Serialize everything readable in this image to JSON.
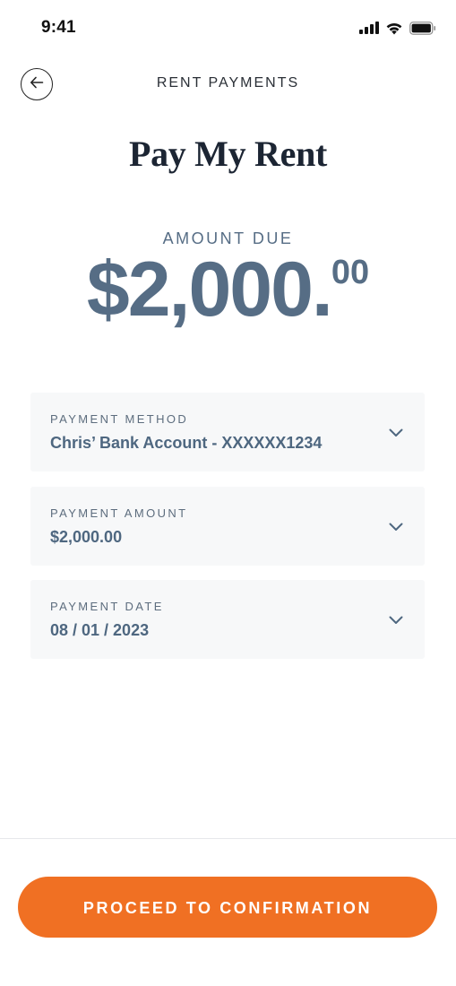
{
  "status_bar": {
    "time": "9:41",
    "icons": [
      "cellular-signal-icon",
      "wifi-icon",
      "battery-icon"
    ]
  },
  "header": {
    "back_icon": "arrow-left-icon",
    "nav_title": "RENT PAYMENTS",
    "page_title": "Pay My Rent"
  },
  "amount_due": {
    "label": "AMOUNT DUE",
    "value_main": "$2,000.",
    "value_cents": "00"
  },
  "fields": [
    {
      "label": "PAYMENT METHOD",
      "value": "Chris’ Bank Account - XXXXXX1234",
      "icon": "chevron-down-icon"
    },
    {
      "label": "PAYMENT AMOUNT",
      "value": "$2,000.00",
      "icon": "chevron-down-icon"
    },
    {
      "label": "PAYMENT DATE",
      "value": "08 / 01 / 2023",
      "icon": "chevron-down-icon"
    }
  ],
  "cta": {
    "label": "PROCEED TO CONFIRMATION"
  },
  "colors": {
    "accent": "#f07023",
    "amount_text": "#566d85",
    "field_bg": "#f7f8f9",
    "title_text": "#1c2533"
  }
}
